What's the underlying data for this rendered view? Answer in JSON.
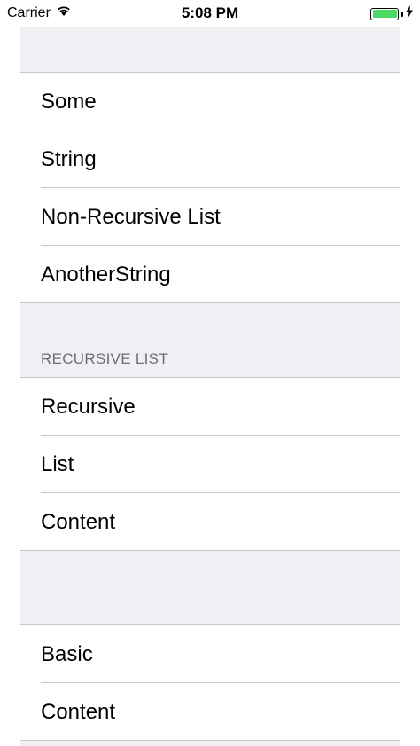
{
  "status_bar": {
    "carrier": "Carrier",
    "time": "5:08 PM",
    "wifi_icon": "wifi-icon",
    "battery_icon": "battery-icon",
    "charging_icon": "bolt-icon",
    "battery_color": "#4cd964"
  },
  "sections": [
    {
      "header": "",
      "items": [
        "Some",
        "String",
        "Non-Recursive List",
        "AnotherString"
      ]
    },
    {
      "header": "RECURSIVE LIST",
      "items": [
        "Recursive",
        "List",
        "Content"
      ]
    },
    {
      "header": "",
      "items": [
        "Basic",
        "Content"
      ]
    }
  ]
}
